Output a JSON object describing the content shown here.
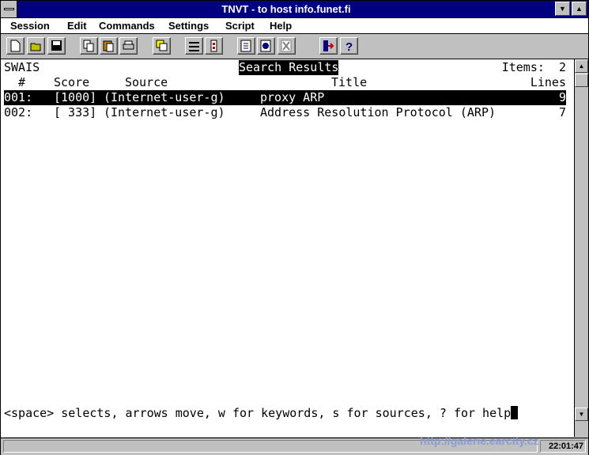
{
  "window": {
    "title": "TNVT - to host info.funet.fi"
  },
  "menu": {
    "items": [
      "Session",
      "Edit",
      "Commands",
      "Settings",
      "Script",
      "Help"
    ]
  },
  "toolbar": {
    "tools": [
      "new-icon",
      "open-icon",
      "save-icon",
      "copy-icon",
      "paste-icon",
      "print-icon",
      "capture-icon",
      "settings-icon",
      "script-icon",
      "upload-icon",
      "download-icon",
      "stop-icon",
      "exit-icon",
      "help-icon"
    ]
  },
  "terminal": {
    "app": "SWAIS",
    "screen_title": "Search Results",
    "items_label": "Items:  2",
    "headers": {
      "num": "#",
      "score": "Score",
      "source": "Source",
      "title": "Title",
      "lines": "Lines"
    },
    "rows": [
      {
        "num": "001:",
        "score": "[1000]",
        "source": "(Internet-user-g)",
        "title": "proxy ARP",
        "lines": "9"
      },
      {
        "num": "002:",
        "score": "[ 333]",
        "source": "(Internet-user-g)",
        "title": "Address Resolution Protocol (ARP)",
        "lines": "7"
      }
    ],
    "prompt": "<space> selects, arrows move, w for keywords, s for sources, ? for help"
  },
  "status": {
    "clock": "22:01:47"
  },
  "watermark": "http://galerie.earcity.cz"
}
